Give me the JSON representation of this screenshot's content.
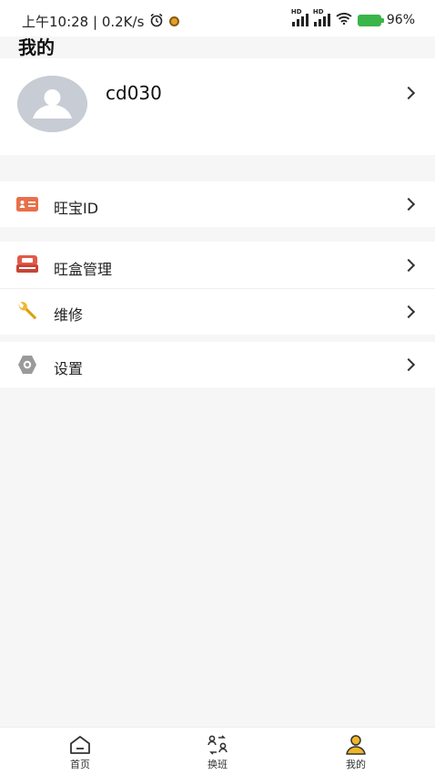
{
  "status": {
    "time_speed": "上午10:28 | 0.2K/s",
    "battery": "96%"
  },
  "header": {
    "title": "我的"
  },
  "profile": {
    "username": "cd030"
  },
  "menu": [
    {
      "id": "wangbao-id",
      "label": "旺宝ID",
      "icon": "id-card-icon",
      "color": "#e8704a"
    },
    {
      "id": "box-manage",
      "label": "旺盒管理",
      "icon": "box-icon",
      "color": "#e05a4a"
    },
    {
      "id": "repair",
      "label": "维修",
      "icon": "wrench-icon",
      "color": "#f0b830"
    },
    {
      "id": "settings",
      "label": "设置",
      "icon": "gear-icon",
      "color": "#999999"
    }
  ],
  "nav": [
    {
      "label": "首页",
      "icon": "home-icon"
    },
    {
      "label": "换班",
      "icon": "shift-swap-icon"
    },
    {
      "label": "我的",
      "icon": "user-icon",
      "active_color": "#f0b62a"
    }
  ]
}
